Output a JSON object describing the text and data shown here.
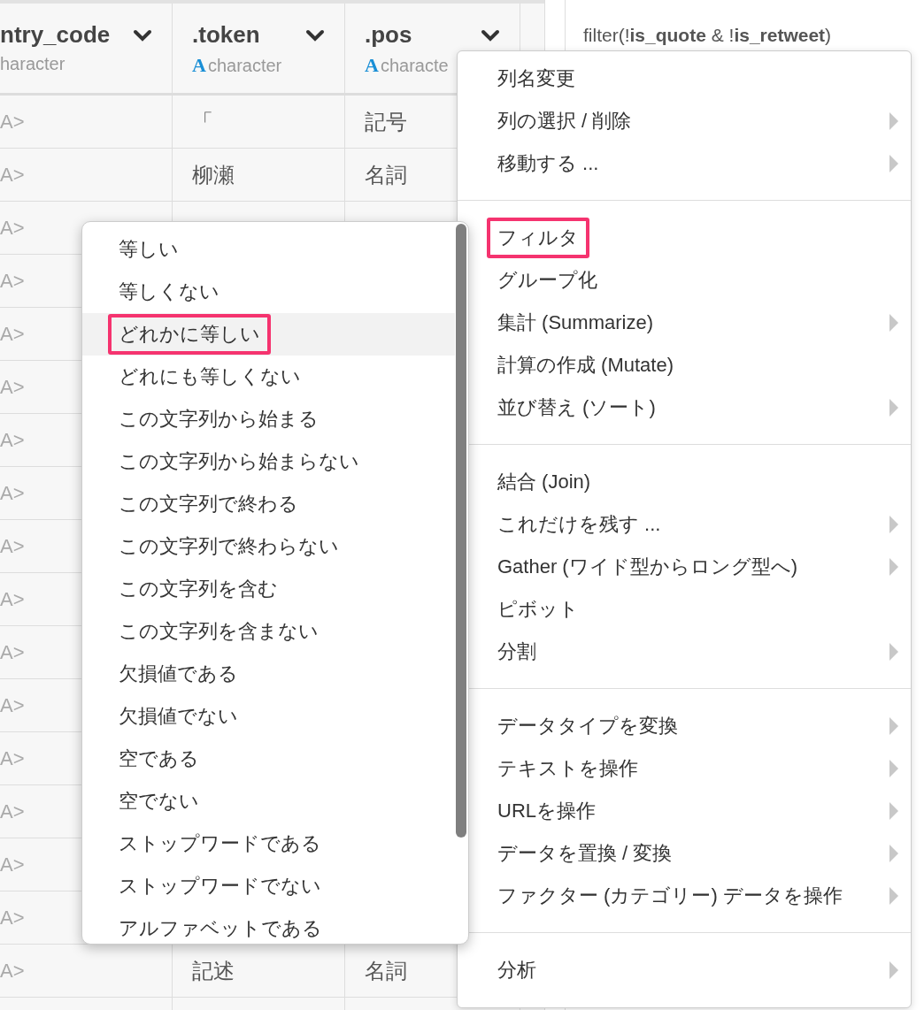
{
  "table": {
    "columns": [
      {
        "name": "ntry_code",
        "type": "haracter"
      },
      {
        "name": ".token",
        "type_icon": "A",
        "type": "character"
      },
      {
        "name": ".pos",
        "type_icon": "A",
        "type": "characte"
      }
    ],
    "rows": [
      {
        "cells": [
          "A>",
          "「",
          "記号"
        ]
      },
      {
        "cells": [
          "A>",
          "柳瀬",
          "名詞"
        ]
      },
      {
        "cells": [
          "A>"
        ]
      },
      {
        "cells": [
          "A>"
        ]
      },
      {
        "cells": [
          "A>"
        ]
      },
      {
        "cells": [
          "A>"
        ]
      },
      {
        "cells": [
          "A>"
        ]
      },
      {
        "cells": [
          "A>"
        ]
      },
      {
        "cells": [
          "A>"
        ]
      },
      {
        "cells": [
          "A>"
        ]
      },
      {
        "cells": [
          "A>"
        ]
      },
      {
        "cells": [
          "A>"
        ]
      },
      {
        "cells": [
          "A>"
        ]
      },
      {
        "cells": [
          "A>"
        ]
      },
      {
        "cells": [
          "A>"
        ]
      },
      {
        "cells": [
          "A>"
        ]
      },
      {
        "cells": [
          "A>",
          "記述",
          "名詞"
        ]
      }
    ]
  },
  "code_panel": {
    "code": "filter(!**is_quote** & !**is_retweet**)"
  },
  "context_menu": {
    "sections": [
      {
        "items": [
          {
            "label": "列名変更",
            "submenu": false,
            "selected": false,
            "outlined": false
          },
          {
            "label": "列の選択 / 削除",
            "submenu": true,
            "selected": false,
            "outlined": false
          },
          {
            "label": "移動する ...",
            "submenu": true,
            "selected": false,
            "outlined": false
          }
        ]
      },
      {
        "items": [
          {
            "label": "フィルタ",
            "submenu": false,
            "selected": false,
            "outlined": true
          },
          {
            "label": "グループ化",
            "submenu": false,
            "selected": false,
            "outlined": false
          },
          {
            "label": "集計 (Summarize)",
            "submenu": true,
            "selected": false,
            "outlined": false
          },
          {
            "label": "計算の作成 (Mutate)",
            "submenu": false,
            "selected": false,
            "outlined": false
          },
          {
            "label": "並び替え (ソート)",
            "submenu": true,
            "selected": false,
            "outlined": false
          }
        ]
      },
      {
        "items": [
          {
            "label": "結合 (Join)",
            "submenu": false,
            "selected": false,
            "outlined": false
          },
          {
            "label": "これだけを残す ...",
            "submenu": true,
            "selected": false,
            "outlined": false
          },
          {
            "label": "Gather (ワイド型からロング型へ)",
            "submenu": true,
            "selected": false,
            "outlined": false
          },
          {
            "label": "ピボット",
            "submenu": false,
            "selected": false,
            "outlined": false
          },
          {
            "label": "分割",
            "submenu": true,
            "selected": false,
            "outlined": false
          }
        ]
      },
      {
        "items": [
          {
            "label": "データタイプを変換",
            "submenu": true,
            "selected": false,
            "outlined": false
          },
          {
            "label": "テキストを操作",
            "submenu": true,
            "selected": false,
            "outlined": false
          },
          {
            "label": "URLを操作",
            "submenu": true,
            "selected": false,
            "outlined": false
          },
          {
            "label": "データを置換 / 変換",
            "submenu": true,
            "selected": false,
            "outlined": false
          },
          {
            "label": "ファクター (カテゴリー) データを操作",
            "submenu": true,
            "selected": false,
            "outlined": false
          }
        ]
      },
      {
        "items": [
          {
            "label": "分析",
            "submenu": true,
            "selected": false,
            "outlined": false
          }
        ]
      }
    ]
  },
  "filter_submenu": {
    "items": [
      {
        "label": "等しい",
        "selected": false,
        "outlined": false
      },
      {
        "label": "等しくない",
        "selected": false,
        "outlined": false
      },
      {
        "label": "どれかに等しい",
        "selected": true,
        "outlined": true
      },
      {
        "label": "どれにも等しくない",
        "selected": false,
        "outlined": false
      },
      {
        "label": "この文字列から始まる",
        "selected": false,
        "outlined": false
      },
      {
        "label": "この文字列から始まらない",
        "selected": false,
        "outlined": false
      },
      {
        "label": "この文字列で終わる",
        "selected": false,
        "outlined": false
      },
      {
        "label": "この文字列で終わらない",
        "selected": false,
        "outlined": false
      },
      {
        "label": "この文字列を含む",
        "selected": false,
        "outlined": false
      },
      {
        "label": "この文字列を含まない",
        "selected": false,
        "outlined": false
      },
      {
        "label": "欠損値である",
        "selected": false,
        "outlined": false
      },
      {
        "label": "欠損値でない",
        "selected": false,
        "outlined": false
      },
      {
        "label": "空である",
        "selected": false,
        "outlined": false
      },
      {
        "label": "空でない",
        "selected": false,
        "outlined": false
      },
      {
        "label": "ストップワードである",
        "selected": false,
        "outlined": false
      },
      {
        "label": "ストップワードでない",
        "selected": false,
        "outlined": false
      },
      {
        "label": "アルファベットである",
        "selected": false,
        "outlined": false
      }
    ]
  }
}
